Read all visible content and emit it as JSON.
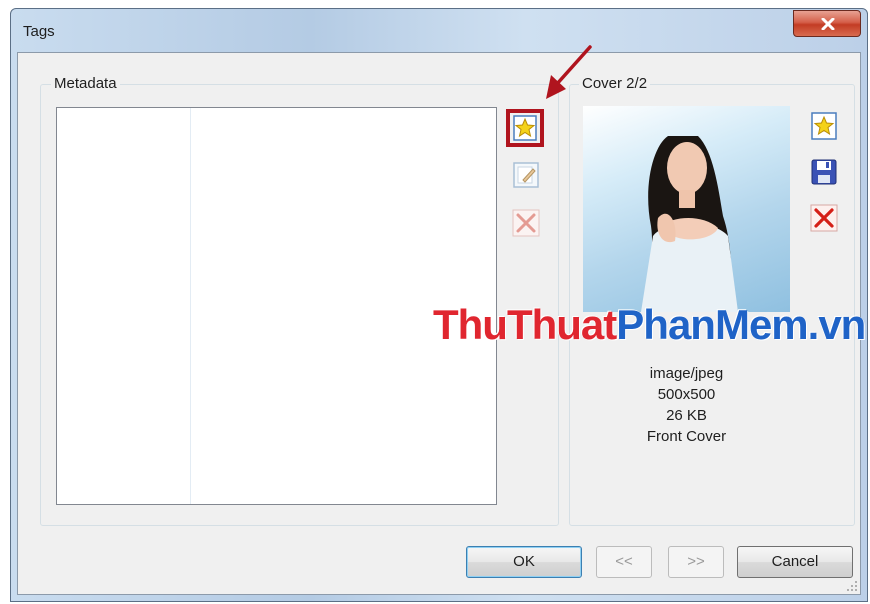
{
  "window": {
    "title": "Tags"
  },
  "metadata_group": {
    "label": "Metadata"
  },
  "cover_group": {
    "label": "Cover 2/2",
    "mime": "image/jpeg",
    "dimensions": "500x500",
    "size": "26 KB",
    "type": "Front Cover"
  },
  "buttons": {
    "ok": "OK",
    "prev": "<<",
    "next": ">>",
    "cancel": "Cancel"
  },
  "watermark": {
    "part1": "ThuThuat",
    "part2": "PhanMem.vn"
  },
  "colors": {
    "accent_red": "#b0141e",
    "watermark_red": "#e0262f",
    "watermark_blue": "#1f63c7"
  },
  "icons": [
    "add-star-icon",
    "edit-icon",
    "delete-icon",
    "save-icon",
    "close-icon"
  ]
}
